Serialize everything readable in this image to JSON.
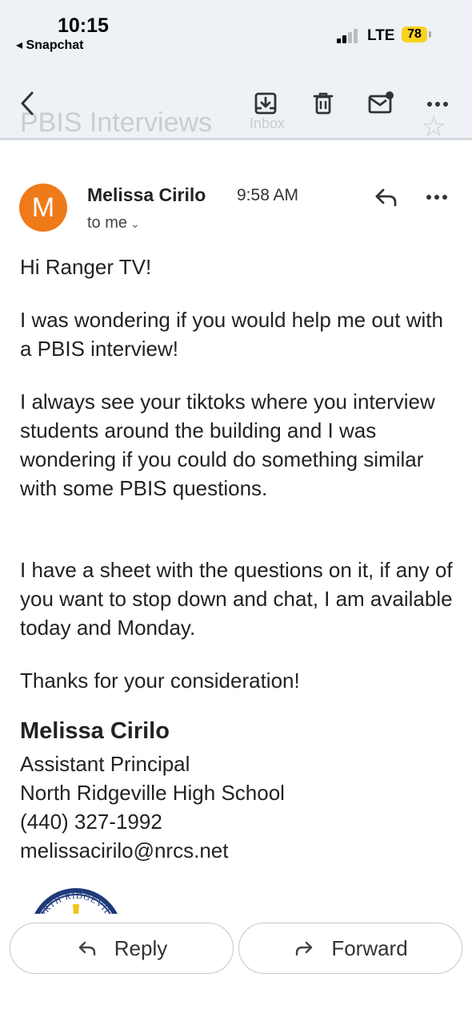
{
  "status_bar": {
    "time": "10:15",
    "back_app": "◂ Snapchat",
    "network": "LTE",
    "battery": "78"
  },
  "toolbar": {
    "subject_partial": "PBIS Interviews",
    "label_partial": "Inbox"
  },
  "message": {
    "avatar_letter": "M",
    "sender": "Melissa Cirilo",
    "time": "9:58 AM",
    "recipients": "to me",
    "body": [
      "Hi Ranger TV!",
      "I was wondering if you would help me out with a PBIS interview!",
      "I always see your tiktoks where you interview students around the building and I was wondering if you could do something similar with some PBIS questions.",
      "I have a sheet with the questions on it, if any of you want to stop down and chat, I am available today and Monday.",
      "Thanks for your consideration!"
    ],
    "signature": {
      "name": "Melissa Cirilo",
      "title": "Assistant Principal",
      "school": "North Ridgeville High School",
      "phone": "(440) 327-1992",
      "email": "melissacirilo@nrcs.net"
    },
    "logo_text": "NORTH RIDGEVILLE"
  },
  "actions": {
    "reply": "Reply",
    "forward": "Forward"
  },
  "colors": {
    "avatar": "#ef7a1a",
    "toolbar_bg": "#eef2f7",
    "battery": "#f7d21e",
    "logo_navy": "#1f3a7a"
  },
  "icons": [
    "chevron-left-icon",
    "archive-icon",
    "trash-icon",
    "mark-unread-icon",
    "more-icon",
    "star-icon",
    "reply-icon",
    "forward-icon"
  ]
}
